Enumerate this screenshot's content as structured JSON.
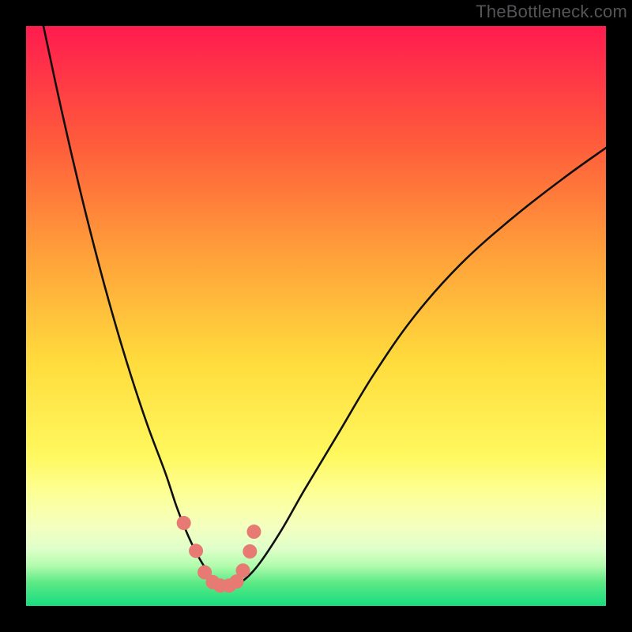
{
  "watermark": "TheBottleneck.com",
  "chart_data": {
    "type": "line",
    "title": "",
    "xlabel": "",
    "ylabel": "",
    "xlim": [
      0,
      100
    ],
    "ylim": [
      0,
      100
    ],
    "grid": false,
    "gradient_stops": [
      {
        "offset": 0,
        "color": "#ff1b4f"
      },
      {
        "offset": 20,
        "color": "#ff5b3b"
      },
      {
        "offset": 40,
        "color": "#ffa23a"
      },
      {
        "offset": 58,
        "color": "#ffdc3d"
      },
      {
        "offset": 74,
        "color": "#fff85e"
      },
      {
        "offset": 80,
        "color": "#fdff91"
      },
      {
        "offset": 86,
        "color": "#f5ffbe"
      },
      {
        "offset": 90,
        "color": "#e0ffca"
      },
      {
        "offset": 93,
        "color": "#b3fcae"
      },
      {
        "offset": 96,
        "color": "#5ce985"
      },
      {
        "offset": 100,
        "color": "#18dd80"
      }
    ],
    "series": [
      {
        "name": "bottleneck-curve",
        "x": [
          3,
          6,
          9,
          12,
          15,
          18,
          21,
          24,
          26,
          28,
          30,
          32,
          33.5,
          35,
          37,
          40,
          44,
          48,
          54,
          60,
          67,
          75,
          84,
          93,
          100
        ],
        "y": [
          100,
          86,
          73,
          61,
          50,
          40,
          31,
          23,
          17,
          12,
          8,
          5,
          3.5,
          3,
          4,
          7,
          13,
          20,
          30,
          40,
          50,
          59,
          67,
          74,
          79
        ]
      }
    ],
    "markers": {
      "name": "highlight-points",
      "color": "#e77a72",
      "radius_px": 9,
      "x": [
        27.2,
        29.3,
        30.8,
        32.2,
        33.5,
        35.0,
        36.3,
        37.4,
        38.6,
        39.3
      ],
      "y": [
        14.3,
        9.5,
        5.8,
        4.1,
        3.5,
        3.5,
        4.2,
        6.1,
        9.4,
        12.8
      ]
    }
  }
}
